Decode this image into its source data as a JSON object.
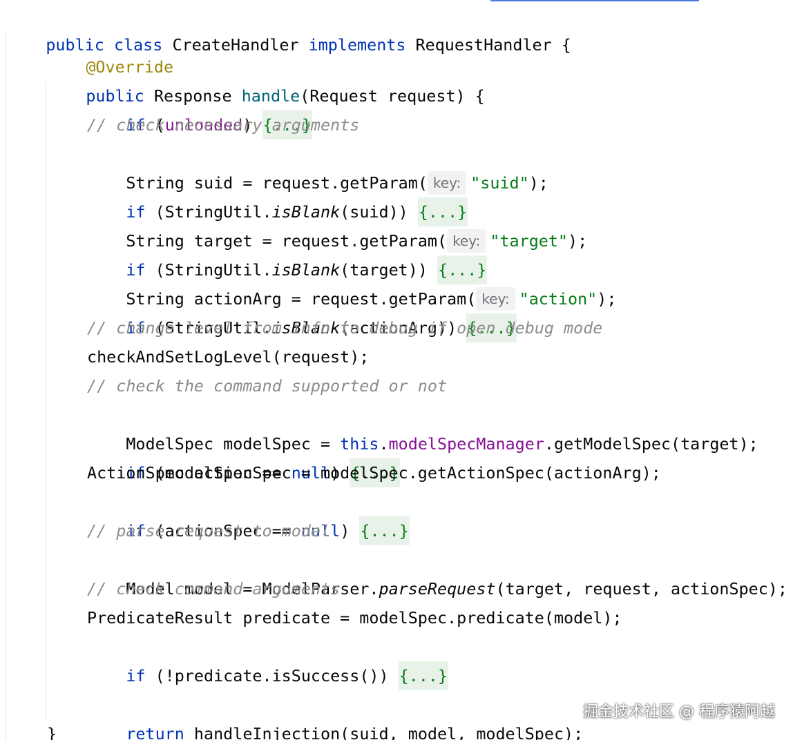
{
  "editor": {
    "class_decl": {
      "kw1": "public",
      "kw2": "class",
      "name": "CreateHandler",
      "kw3": "implements",
      "iface": "RequestHandler",
      "brace": "{"
    },
    "annotation": "@Override",
    "method_decl": {
      "kw": "public",
      "type": "Response",
      "name": "handle",
      "params": "(Request request) {"
    },
    "fold_text": "{...}",
    "hint_key": "key:",
    "lines": {
      "l1_if": "if",
      "l1_open": " (",
      "l1_field": "unloaded",
      "l1_close": ") ",
      "c1": "// check necessary arguments",
      "l3_a": "String suid = request.getParam(",
      "l3_str": "\"suid\"",
      "l3_end": ");",
      "l4_if": "if",
      "l4_a": " (StringUtil.",
      "l4_it": "isBlank",
      "l4_b": "(suid)) ",
      "l5_a": "String target = request.getParam(",
      "l5_str": "\"target\"",
      "l5_end": ");",
      "l6_if": "if",
      "l6_a": " (StringUtil.",
      "l6_it": "isBlank",
      "l6_b": "(target)) ",
      "l7_a": "String actionArg = request.getParam(",
      "l7_str": "\"action\"",
      "l7_end": ");",
      "l8_if": "if",
      "l8_a": " (StringUtil.",
      "l8_it": "isBlank",
      "l8_b": "(actionArg)) ",
      "c2": "// change level from info to debug if open debug mode",
      "l10": "checkAndSetLogLevel(request);",
      "c3": "// check the command supported or not",
      "l12_a": "ModelSpec modelSpec = ",
      "l12_this": "this",
      "l12_dot": ".",
      "l12_field": "modelSpecManager",
      "l12_b": ".getModelSpec(target);",
      "l13_if": "if",
      "l13_a": " (modelSpec == ",
      "l13_null": "null",
      "l13_b": ") ",
      "l14": "ActionSpec actionSpec = modelSpec.getActionSpec(actionArg);",
      "l15_if": "if",
      "l15_a": " (actionSpec == ",
      "l15_null": "null",
      "l15_b": ") ",
      "c4": "// parse request to model",
      "l17_a": "Model model = ModelParser.",
      "l17_it": "parseRequest",
      "l17_b": "(target, request, actionSpec);",
      "c5": "// check command arguments",
      "l19": "PredicateResult predicate = modelSpec.predicate(model);",
      "l20_if": "if",
      "l20_a": " (!predicate.isSuccess()) ",
      "l22_ret": "return",
      "l22_a": " handleInjection(suid, model, modelSpec);",
      "closing": "}"
    }
  },
  "watermark": "掘金技术社区 @ 程序猿阿越"
}
